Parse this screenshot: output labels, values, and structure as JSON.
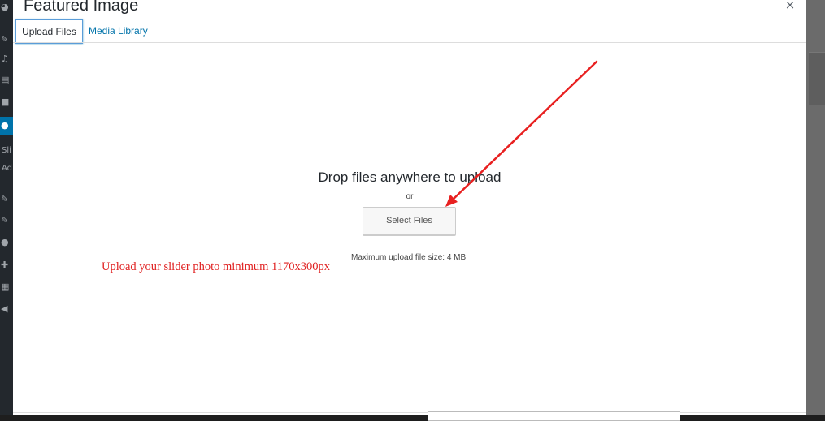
{
  "modal": {
    "title": "Featured Image",
    "close_glyph": "×"
  },
  "tabs": [
    {
      "label": "Upload Files",
      "active": true
    },
    {
      "label": "Media Library",
      "active": false
    }
  ],
  "uploader": {
    "drop_text": "Drop files anywhere to upload",
    "or_text": "or",
    "select_button": "Select Files",
    "max_size_text": "Maximum upload file size: 4 MB."
  },
  "annotation": {
    "text": "Upload your slider photo minimum 1170x300px",
    "color": "#e02020"
  },
  "admin_sidebar": {
    "partial_labels": [
      "Sli",
      "Ad"
    ],
    "icons": [
      "dashboard-icon",
      "pin-icon",
      "media-icon",
      "pages-icon",
      "comments-icon",
      "users-icon",
      "appearance-icon",
      "plugins-icon",
      "users-icon",
      "tools-icon",
      "settings-icon",
      "collapse-icon"
    ]
  },
  "colors": {
    "accent": "#0073aa",
    "sidebar_bg": "#23282d",
    "focus_border": "#5b9dd9"
  }
}
